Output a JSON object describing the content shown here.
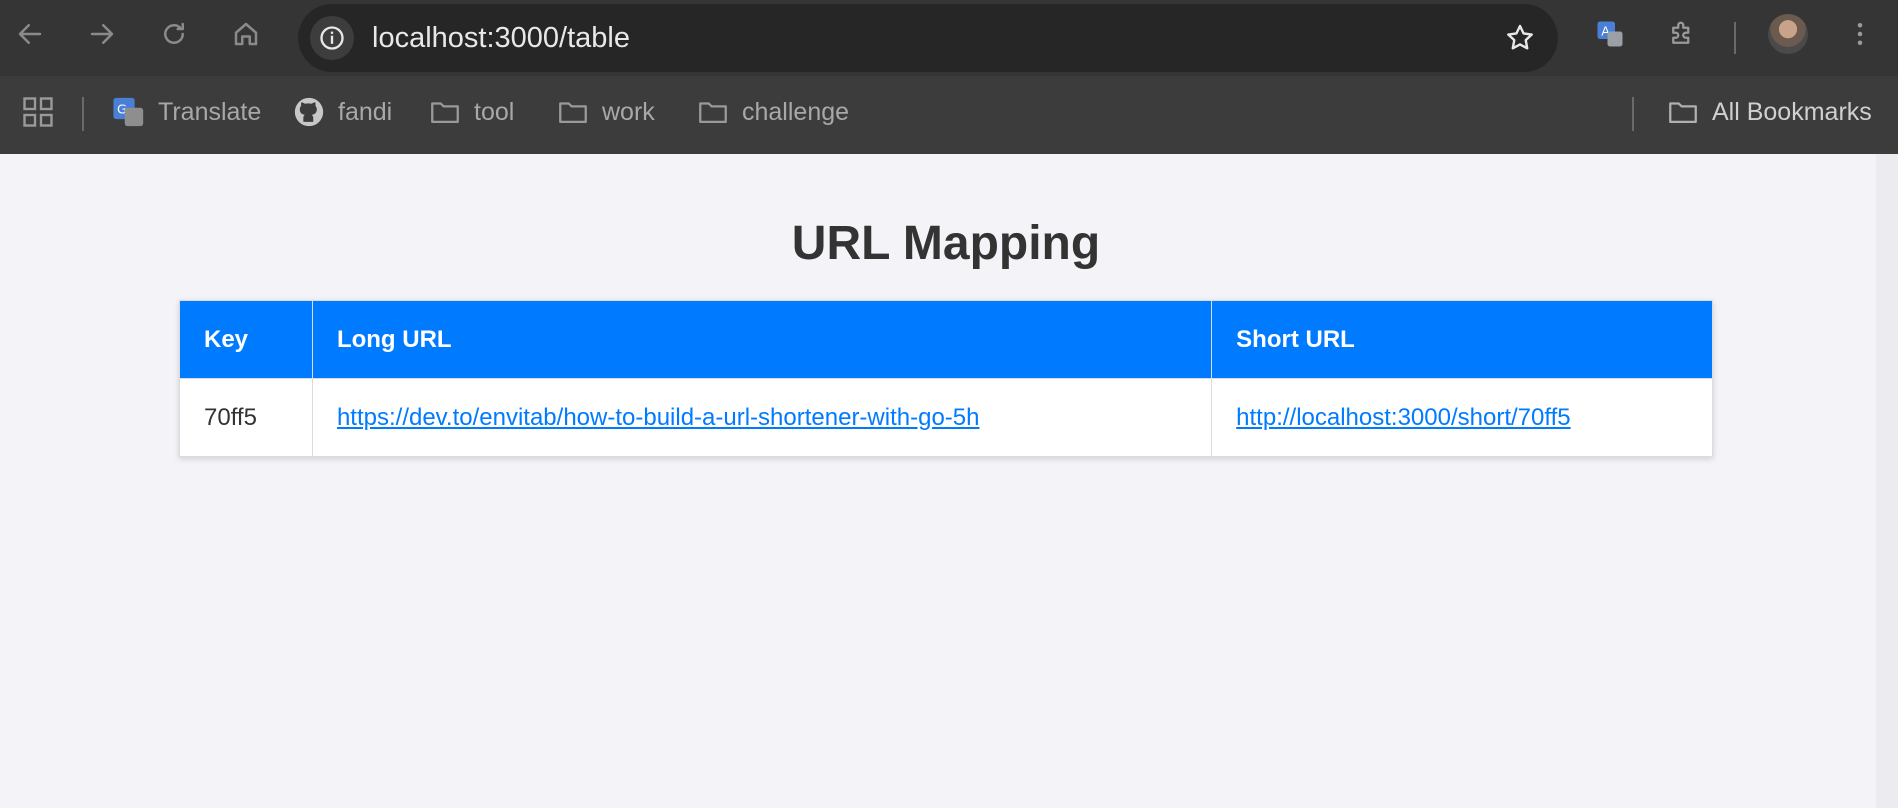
{
  "browser": {
    "url": "localhost:3000/table",
    "bookmarks": [
      {
        "label": "Translate",
        "icon": "google-translate-icon"
      },
      {
        "label": "fandi",
        "icon": "github-icon"
      },
      {
        "label": "tool",
        "icon": "folder-icon"
      },
      {
        "label": "work",
        "icon": "folder-icon"
      },
      {
        "label": "challenge",
        "icon": "folder-icon"
      }
    ],
    "all_bookmarks": "All Bookmarks"
  },
  "page": {
    "title": "URL Mapping",
    "table": {
      "headers": [
        "Key",
        "Long URL",
        "Short URL"
      ],
      "rows": [
        {
          "key": "70ff5",
          "long_url": "https://dev.to/envitab/how-to-build-a-url-shortener-with-go-5h",
          "short_url": "http://localhost:3000/short/70ff5"
        }
      ]
    }
  },
  "colors": {
    "header_bg": "#007bff",
    "link": "#007bff",
    "page_bg": "#f4f4f8",
    "chrome_bg": "#353535"
  }
}
